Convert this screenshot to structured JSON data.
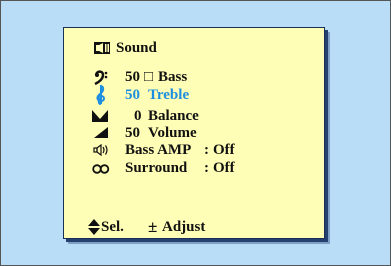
{
  "menu": {
    "title": "Sound",
    "title_icon": "speaker-icon",
    "items": [
      {
        "icon": "bass-clef-icon",
        "value": "50",
        "marker": "□",
        "label": "Bass",
        "selected": false
      },
      {
        "icon": "treble-clef-icon",
        "value": "50",
        "label": "Treble",
        "selected": true
      },
      {
        "icon": "balance-icon",
        "value": "0",
        "label": "Balance",
        "selected": false
      },
      {
        "icon": "volume-icon",
        "value": "50",
        "label": "Volume",
        "selected": false
      },
      {
        "icon": "bass-amp-icon",
        "label": "Bass AMP",
        "separator": ":",
        "state": "Off",
        "selected": false
      },
      {
        "icon": "surround-icon",
        "label": "Surround",
        "separator": ":",
        "state": "Off",
        "selected": false
      }
    ],
    "footer": {
      "select_icon": "up-down-arrows-icon",
      "select_label": "Sel.",
      "adjust_icon": "plus-minus-icon",
      "adjust_symbol": "±",
      "adjust_label": "Adjust"
    }
  },
  "colors": {
    "background": "#b9ddf7",
    "osd_background": "#fffeb6",
    "highlight": "#1e8fe0",
    "text": "#111111",
    "border": "#1a2f5a"
  }
}
